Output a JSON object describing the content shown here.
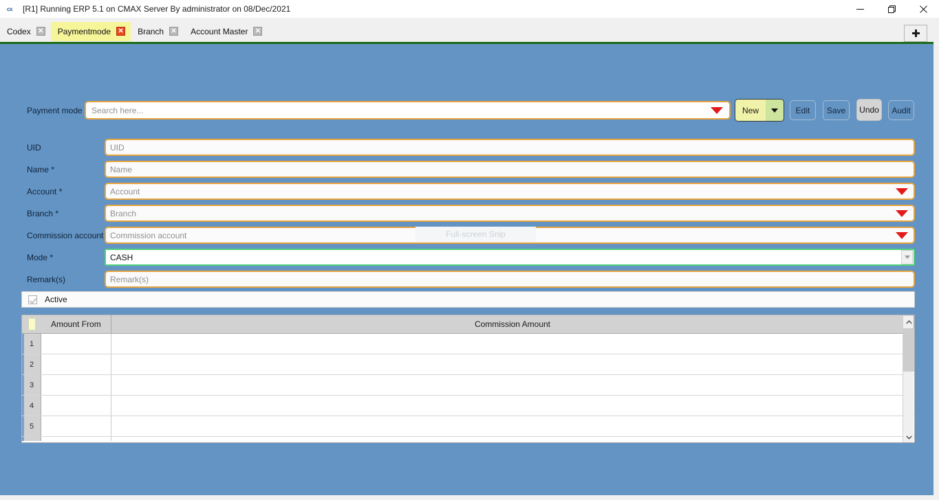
{
  "window": {
    "icon": "cx-app-icon",
    "title": "[R1] Running ERP 5.1 on CMAX Server By administrator on 08/Dec/2021",
    "controls": {
      "minimize": "minimize-icon",
      "restore": "restore-icon",
      "close": "close-icon"
    }
  },
  "tabs": {
    "items": [
      {
        "label": "Codex",
        "active": false,
        "close": "✕"
      },
      {
        "label": "Paymentmode",
        "active": true,
        "close": "✕"
      },
      {
        "label": "Branch",
        "active": false,
        "close": "✕"
      },
      {
        "label": "Account Master",
        "active": false,
        "close": "✕"
      }
    ],
    "new_tab_label": "+"
  },
  "search_row": {
    "label": "Payment mode",
    "placeholder": "Search here...",
    "value": "",
    "dropdown_icon": "red-caret-down-icon"
  },
  "actions": {
    "new_label": "New",
    "new_dropdown_icon": "black-caret-down-icon",
    "edit_label": "Edit",
    "save_label": "Save",
    "undo_label": "Undo",
    "audit_label": "Audit"
  },
  "form": {
    "fields": [
      {
        "label": "UID",
        "placeholder": "UID",
        "value": "",
        "type": "text"
      },
      {
        "label": "Name *",
        "placeholder": "Name",
        "value": "",
        "type": "text"
      },
      {
        "label": "Account *",
        "placeholder": "Account",
        "value": "",
        "type": "combo"
      },
      {
        "label": "Branch *",
        "placeholder": "Branch",
        "value": "",
        "type": "combo"
      },
      {
        "label": "Commission account",
        "placeholder": "Commission account",
        "value": "",
        "type": "combo"
      }
    ],
    "mode": {
      "label": "Mode *",
      "value": "CASH",
      "dropdown_icon": "gray-caret-down-icon"
    },
    "remarks": {
      "label": "Remark(s)",
      "placeholder": "Remark(s)",
      "value": ""
    },
    "active": {
      "label": "Active",
      "checked": true,
      "icon": "checkmark-icon"
    }
  },
  "overlay": {
    "snip_label": "Full-screen Snip"
  },
  "grid": {
    "corner_icon": "select-all-corner-icon",
    "columns": [
      {
        "key": "amount_from",
        "label": "Amount From"
      },
      {
        "key": "commission_amount",
        "label": "Commission Amount"
      }
    ],
    "rows": [
      {
        "num": "1",
        "amount_from": "",
        "commission_amount": ""
      },
      {
        "num": "2",
        "amount_from": "",
        "commission_amount": ""
      },
      {
        "num": "3",
        "amount_from": "",
        "commission_amount": ""
      },
      {
        "num": "4",
        "amount_from": "",
        "commission_amount": ""
      },
      {
        "num": "5",
        "amount_from": "",
        "commission_amount": ""
      }
    ],
    "scrollbar": {
      "up_icon": "chevron-up-icon",
      "down_icon": "chevron-down-icon"
    }
  },
  "colors": {
    "canvas_blue": "#6394c4",
    "field_border_orange": "#e8a33d",
    "mode_border_green": "#4fd07a",
    "active_tab_yellow": "#f7f59a",
    "new_button_yellow": "#eff2a8",
    "new_button_green": "#cde49e",
    "accent_green_bar": "#1d6b16",
    "dropdown_red": "#e31a1a",
    "close_tab_red": "#e8471c"
  }
}
